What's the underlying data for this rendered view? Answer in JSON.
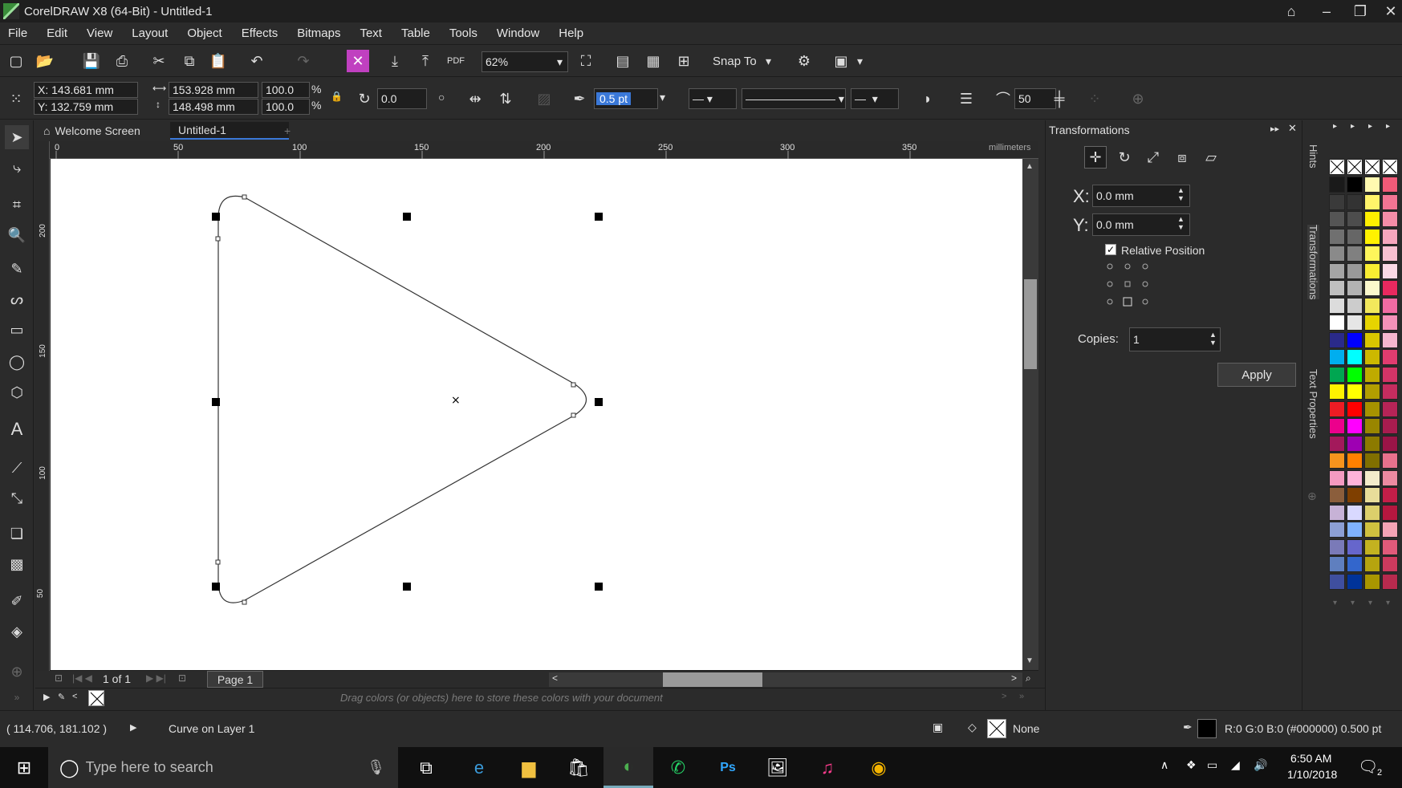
{
  "window": {
    "title": "CorelDRAW X8 (64-Bit) - Untitled-1"
  },
  "menu": [
    "File",
    "Edit",
    "View",
    "Layout",
    "Object",
    "Effects",
    "Bitmaps",
    "Text",
    "Table",
    "Tools",
    "Window",
    "Help"
  ],
  "toolbar1": {
    "zoom": "62%",
    "snap_to": "Snap To"
  },
  "toolbar2": {
    "x": "X: 143.681 mm",
    "y": "Y: 132.759 mm",
    "width": "153.928 mm",
    "height": "148.498 mm",
    "scale_x": "100.0",
    "scale_y": "100.0",
    "pct": "%",
    "rotation": "0.0",
    "outline_width": "0.5 pt",
    "curve_smoothing": "50"
  },
  "tabs": {
    "welcome": "Welcome Screen",
    "doc": "Untitled-1"
  },
  "ruler": {
    "h_ticks": [
      "0",
      "50",
      "100",
      "150",
      "200",
      "250",
      "300",
      "350"
    ],
    "units": "millimeters",
    "v_ticks": [
      "200",
      "150",
      "100",
      "50"
    ]
  },
  "pagebar": {
    "page_count": "1 of 1",
    "page_tab": "Page 1"
  },
  "colorbar": {
    "hint": "Drag colors (or objects) here to store these colors with your document"
  },
  "status": {
    "coords": "( 114.706, 181.102 )",
    "object_info": "Curve on Layer 1",
    "fill": "None",
    "outline": "R:0 G:0 B:0 (#000000)  0.500 pt"
  },
  "panel": {
    "title": "Transformations",
    "x_label": "X:",
    "x_value": "0.0 mm",
    "y_label": "Y:",
    "y_value": "0.0 mm",
    "relative_position": "Relative Position",
    "copies_label": "Copies:",
    "copies_value": "1",
    "apply": "Apply"
  },
  "side_tabs": [
    "Hints",
    "Transformations",
    "Text Properties"
  ],
  "palette_colors": {
    "col1": [
      "#1a1a1a",
      "#3a3a3a",
      "#555555",
      "#707070",
      "#8a8a8a",
      "#a5a5a5",
      "#c0c0c0",
      "#dcdcdc",
      "#ffffff",
      "#2a2a8a",
      "#00aeef",
      "#00a651",
      "#fff200",
      "#ed1c24",
      "#ec008c",
      "#a3195b",
      "#f7941d",
      "#f49ac1",
      "#8b5e3c",
      "#c7b2d6",
      "#8c9fd4",
      "#7a7ab8",
      "#5f7fbf",
      "#3f4f9f"
    ],
    "col2": [
      "#000000",
      "#333333",
      "#4d4d4d",
      "#666666",
      "#808080",
      "#999999",
      "#b3b3b3",
      "#cccccc",
      "#e6e6e6",
      "#0000ff",
      "#00ffff",
      "#00ff00",
      "#ffff00",
      "#ff0000",
      "#ff00ff",
      "#9e00b3",
      "#ff8000",
      "#ffb3d9",
      "#7f3f00",
      "#d9d9ff",
      "#7fb2ff",
      "#6666cc",
      "#3366cc",
      "#003399"
    ],
    "col3": [
      "#fff9b0",
      "#fff46a",
      "#ffef00",
      "#fff200",
      "#fef65b",
      "#f9ed32",
      "#fbf8cc",
      "#f2e85c",
      "#e6d400",
      "#d9c500",
      "#ccb800",
      "#bfab00",
      "#b29e00",
      "#a69200",
      "#998600",
      "#8c7a00",
      "#806f00",
      "#f3eccb",
      "#e8dd9a",
      "#dccf6b",
      "#cfc03f",
      "#c3b220",
      "#b6a40f",
      "#a99600"
    ],
    "col4": [
      "#f05a78",
      "#f27493",
      "#f48da8",
      "#f6a6bd",
      "#f8c0d1",
      "#fad9e6",
      "#e8295f",
      "#f06ba3",
      "#f391b9",
      "#f6b7cf",
      "#e03c6f",
      "#d23467",
      "#c42c5f",
      "#b62457",
      "#a81c4f",
      "#9a1447",
      "#e8718d",
      "#ec8aa1",
      "#c31e48",
      "#b5173f",
      "#f4a3b5",
      "#e05a7a",
      "#cc3a5e",
      "#b82a4e"
    ]
  },
  "taskbar": {
    "search_placeholder": "Type here to search",
    "time": "6:50 AM",
    "date": "1/10/2018",
    "notifications": "2"
  }
}
